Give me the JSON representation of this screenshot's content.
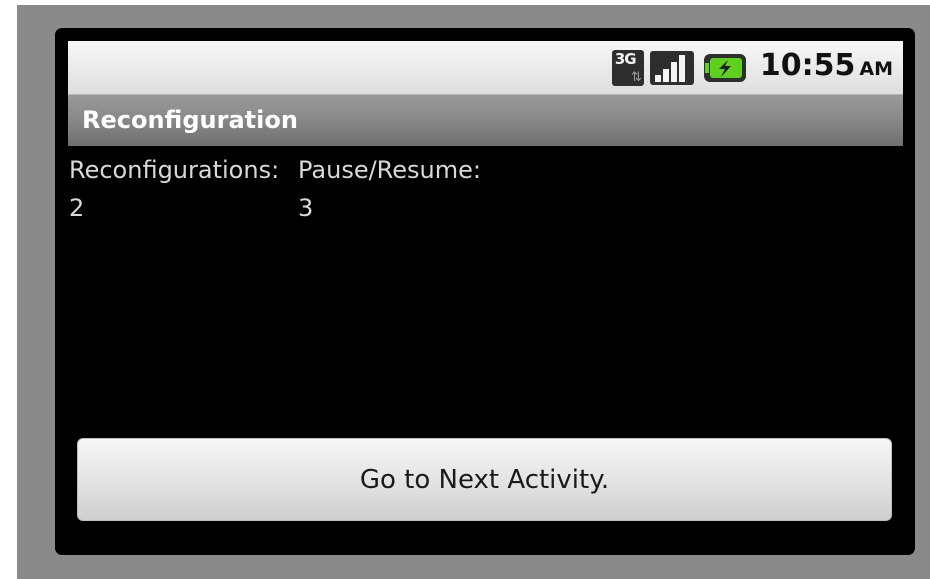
{
  "status_bar": {
    "network_label": "3G",
    "network_arrows": "⇅",
    "time": "10:55",
    "ampm": "AM",
    "icons": [
      "3g-data-icon",
      "signal-strength-icon",
      "battery-charging-icon"
    ]
  },
  "action_bar": {
    "title": "Reconfiguration"
  },
  "content": {
    "reconfigurations_label": "Reconfigurations:",
    "reconfigurations_value": "2",
    "pause_resume_label": "Pause/Resume:",
    "pause_resume_value": "3"
  },
  "button": {
    "label": "Go to Next Activity."
  },
  "colors": {
    "background": "#000000",
    "title_bar": "#8a8a8a",
    "status_bar": "#e8e8e8",
    "text": "#d9d9d9",
    "battery_green": "#5fd020"
  }
}
